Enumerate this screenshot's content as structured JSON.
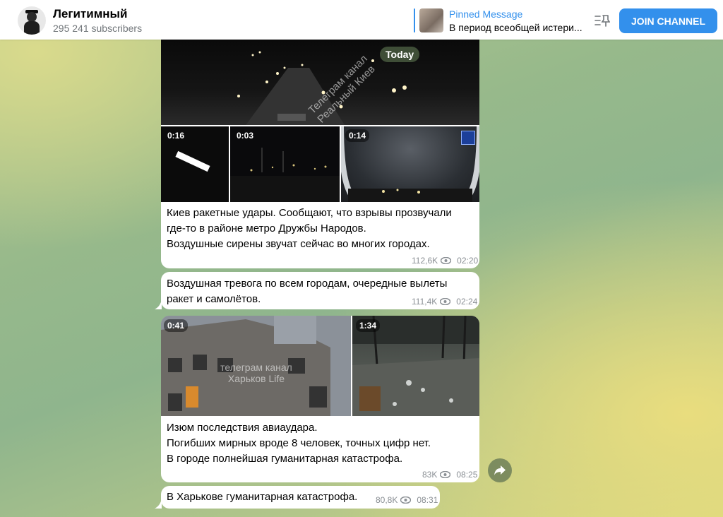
{
  "header": {
    "channel_name": "Легитимный",
    "subscribers": "295 241 subscribers",
    "pinned_label": "Pinned Message",
    "pinned_text": "В период всеобщей истери...",
    "join_label": "JOIN CHANNEL"
  },
  "date_badge": "Today",
  "messages": [
    {
      "media_durations": [
        "0:16",
        "0:03",
        "0:14"
      ],
      "watermark": "Телеграм канал Реальный Киев",
      "caption_lines": [
        "Киев ракетные удары. Сообщают, что взрывы прозвучали",
        "где-то в районе метро Дружбы Народов.",
        "Воздушные сирены звучат сейчас во многих городах."
      ],
      "views": "112,6K",
      "time": "02:20"
    },
    {
      "caption_lines": [
        "Воздушная тревога по всем городам, очередные вылеты",
        "ракет и самолётов."
      ],
      "views": "111,4K",
      "time": "02:24"
    },
    {
      "media_durations": [
        "0:41",
        "1:34"
      ],
      "watermark_line1": "телеграм канал",
      "watermark_line2": "Харьков Life",
      "caption_lines": [
        "Изюм последствия авиаудара.",
        "Погибших мирных вроде 8 человек, точных цифр нет.",
        "В городе полнейшая гуманитарная катастрофа."
      ],
      "views": "83K",
      "time": "08:25"
    },
    {
      "caption_lines": [
        "В Харькове гуманитарная катастрофа."
      ],
      "views": "80,8K",
      "time": "08:31"
    }
  ],
  "colors": {
    "accent": "#3390ec",
    "meta_text": "#8a8f94"
  },
  "icons": {
    "pinned_list": "pinned-list-icon",
    "views": "eye-icon",
    "share": "share-arrow-icon"
  }
}
